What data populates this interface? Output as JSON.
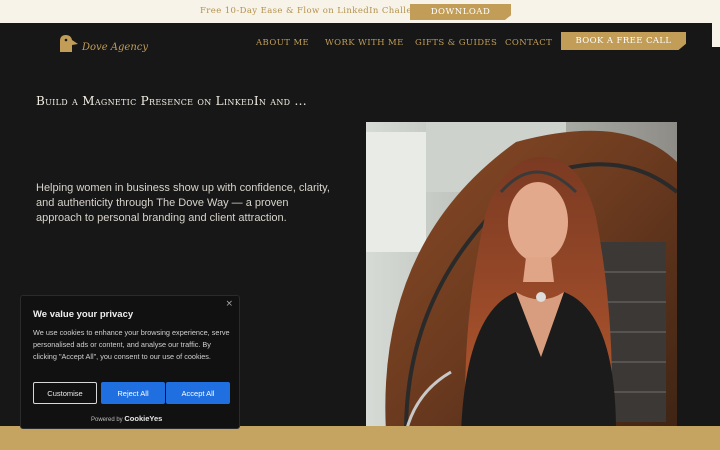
{
  "topbar": {
    "promo_text": "Free 10-Day Ease & Flow on LinkedIn Challenge",
    "download_label": "Download"
  },
  "header": {
    "logo_text": "Dove Agency",
    "nav": [
      {
        "label": "About me"
      },
      {
        "label": "Work with me"
      },
      {
        "label": "Gifts & Guides"
      },
      {
        "label": "Contact"
      }
    ],
    "cta_label": "Book a free call"
  },
  "hero": {
    "title": "Build a Magnetic Presence on LinkedIn and ...",
    "description": "Helping women in business show up with confidence, clarity, and authenticity through The Dove Way — a proven approach to personal branding and client attraction."
  },
  "cookie_banner": {
    "close_label": "×",
    "title": "We value your privacy",
    "body": "We use cookies to enhance your browsing experience, serve personalised ads or content, and analyse our traffic. By clicking \"Accept All\", you consent to our use of cookies.",
    "customise_label": "Customise",
    "reject_label": "Reject All",
    "accept_label": "Accept All",
    "powered_prefix": "Powered by",
    "powered_brand": "CookieYes"
  },
  "colors": {
    "gold": "#c19d57",
    "cream": "#f7f3e9",
    "background": "#171717",
    "cookie_button_blue": "#1f6fe0"
  }
}
